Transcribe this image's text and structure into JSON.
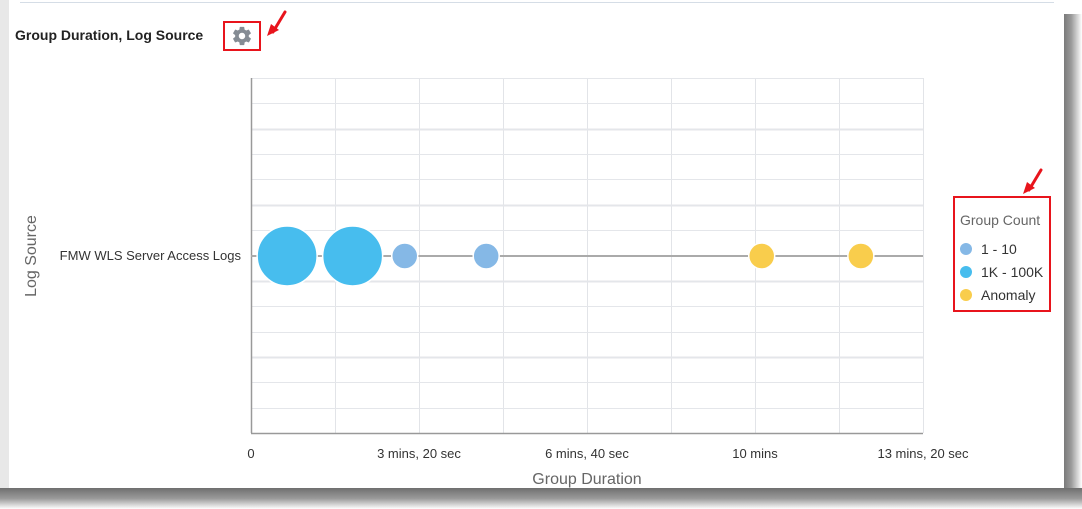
{
  "panel": {
    "title": "Group Duration, Log Source",
    "settings_icon": "gear-icon"
  },
  "colors": {
    "series_1_10": "#85b8e6",
    "series_1k_100k": "#47bdee",
    "series_anomaly": "#f9cd4c",
    "annotation": "#e8141c",
    "connector": "#aaaaaa",
    "grid": "#e4e6ea",
    "axis": "#999999"
  },
  "chart_data": {
    "type": "scatter",
    "subtype": "bubble",
    "title": "Group Duration, Log Source",
    "xlabel": "Group Duration",
    "ylabel": "Log Source",
    "x_unit": "seconds",
    "xlim": [
      0,
      800
    ],
    "x_ticks": [
      {
        "value": 0,
        "label": "0"
      },
      {
        "value": 200,
        "label": "3 mins, 20 sec"
      },
      {
        "value": 400,
        "label": "6 mins, 40 sec"
      },
      {
        "value": 600,
        "label": "10 mins"
      },
      {
        "value": 800,
        "label": "13 mins, 20 sec"
      }
    ],
    "categories": [
      "FMW WLS Server Access Logs"
    ],
    "grid": true,
    "legend": {
      "title": "Group Count",
      "position": "right",
      "entries": [
        "1 - 10",
        "1K - 100K",
        "Anomaly"
      ]
    },
    "series": [
      {
        "name": "1K - 100K",
        "color": "#47bdee",
        "points": [
          {
            "category": "FMW WLS Server Access Logs",
            "x": 43,
            "size": "large"
          },
          {
            "category": "FMW WLS Server Access Logs",
            "x": 121,
            "size": "large"
          }
        ]
      },
      {
        "name": "1 - 10",
        "color": "#85b8e6",
        "points": [
          {
            "category": "FMW WLS Server Access Logs",
            "x": 183,
            "size": "small"
          },
          {
            "category": "FMW WLS Server Access Logs",
            "x": 280,
            "size": "small"
          }
        ]
      },
      {
        "name": "Anomaly",
        "color": "#f9cd4c",
        "points": [
          {
            "category": "FMW WLS Server Access Logs",
            "x": 608,
            "size": "small"
          },
          {
            "category": "FMW WLS Server Access Logs",
            "x": 726,
            "size": "small"
          }
        ]
      }
    ]
  }
}
